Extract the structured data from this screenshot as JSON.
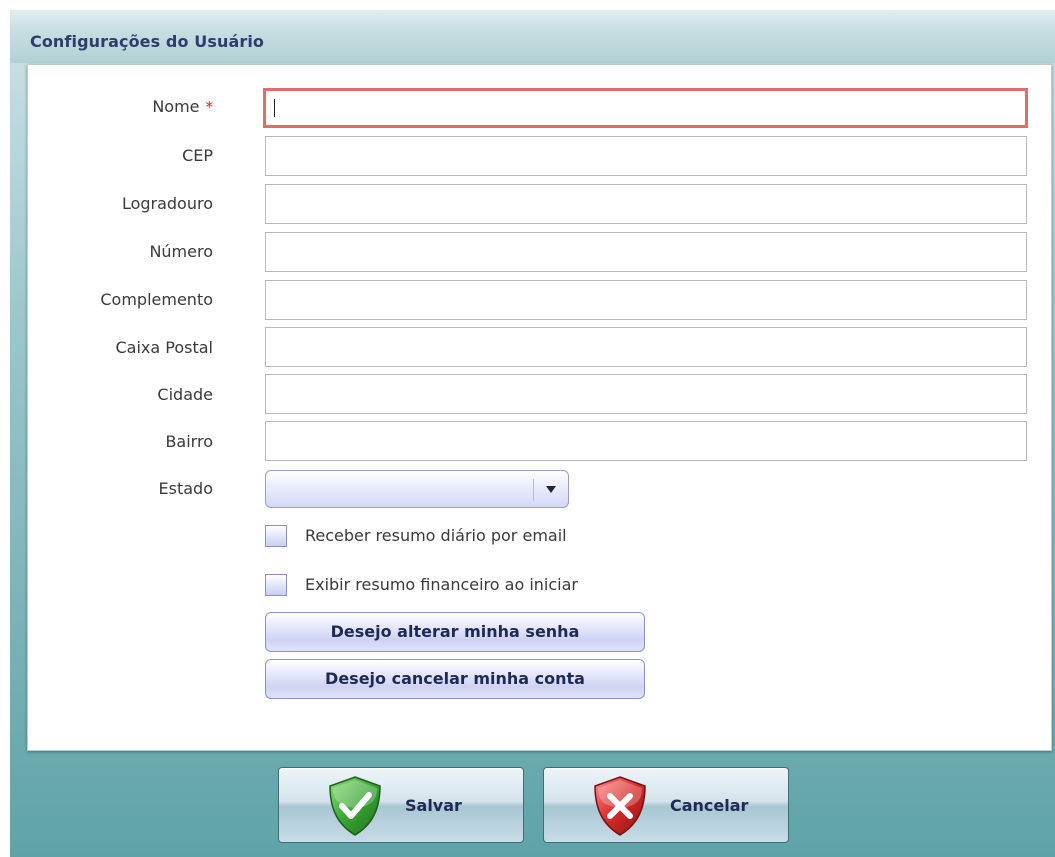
{
  "window": {
    "title": "Configurações do Usuário"
  },
  "form": {
    "fields": [
      {
        "label": "Nome",
        "required": true,
        "value": ""
      },
      {
        "label": "CEP",
        "value": ""
      },
      {
        "label": "Logradouro",
        "value": ""
      },
      {
        "label": "Número",
        "value": ""
      },
      {
        "label": "Complemento",
        "value": ""
      },
      {
        "label": "Caixa Postal",
        "value": ""
      },
      {
        "label": "Cidade",
        "value": ""
      },
      {
        "label": "Bairro",
        "value": ""
      }
    ],
    "required_marker": "*",
    "estado": {
      "label": "Estado",
      "value": "",
      "icon": "chevron-down-icon"
    },
    "checkboxes": [
      {
        "label": "Receber resumo diário por email",
        "checked": false
      },
      {
        "label": "Exibir resumo financeiro ao iniciar",
        "checked": false
      }
    ],
    "buttons": {
      "change_password": "Desejo alterar minha senha",
      "cancel_account": "Desejo cancelar minha conta"
    }
  },
  "footer": {
    "save": {
      "label": "Salvar",
      "icon": "shield-check-icon",
      "icon_color": "#3aa534"
    },
    "cancel": {
      "label": "Cancelar",
      "icon": "shield-x-icon",
      "icon_color": "#d62b2b"
    }
  },
  "colors": {
    "invalid_border": "#e06c6c",
    "title_text": "#2b3f6e",
    "button_text": "#1e2a55"
  }
}
